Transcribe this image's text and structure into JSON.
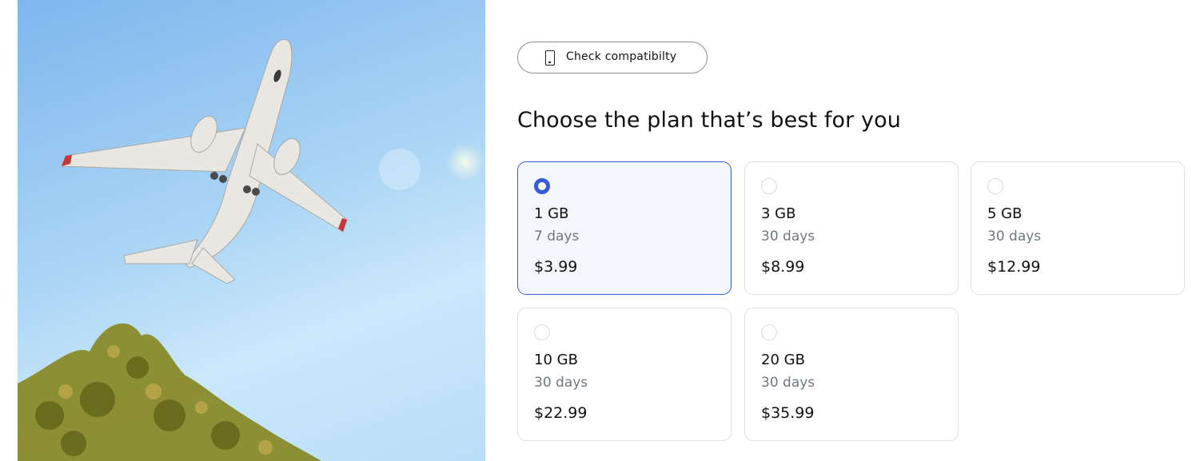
{
  "hero": {
    "image_icon": "airplane-photo"
  },
  "compat_button": {
    "label": "Check compatibilty",
    "icon": "phone-icon"
  },
  "title": "Choose the plan that’s best for you",
  "accent_color": "#3a5bd9",
  "plans": [
    {
      "size": "1 GB",
      "duration": "7 days",
      "price": "$3.99",
      "selected": true
    },
    {
      "size": "3 GB",
      "duration": "30 days",
      "price": "$8.99",
      "selected": false
    },
    {
      "size": "5 GB",
      "duration": "30 days",
      "price": "$12.99",
      "selected": false
    },
    {
      "size": "10 GB",
      "duration": "30 days",
      "price": "$22.99",
      "selected": false
    },
    {
      "size": "20 GB",
      "duration": "30 days",
      "price": "$35.99",
      "selected": false
    }
  ]
}
